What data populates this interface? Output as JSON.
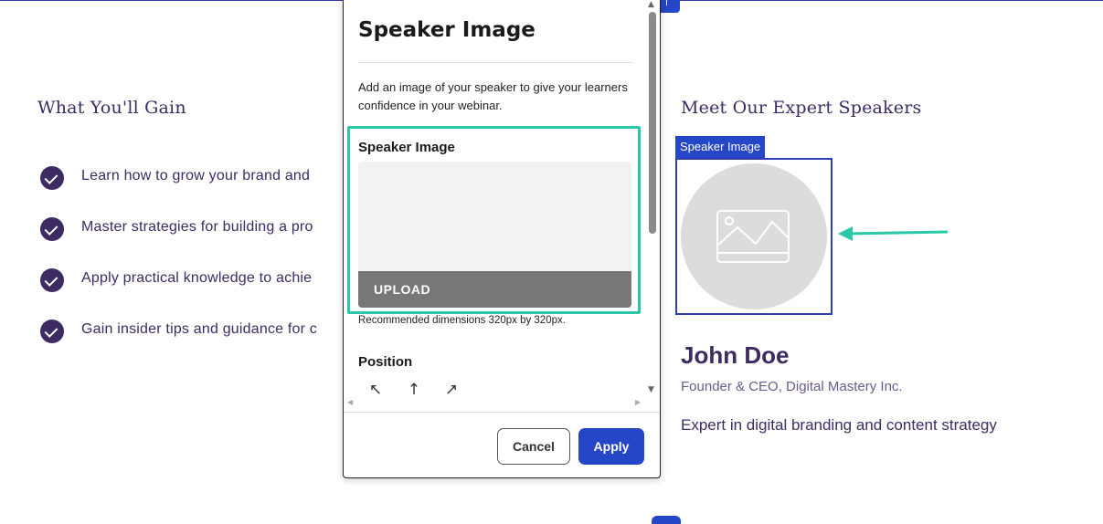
{
  "page": {
    "gain_section": {
      "title": "What You'll Gain",
      "items": [
        "Learn how to grow your brand and",
        "Master strategies for building a pro",
        "Apply practical knowledge to achie",
        "Gain insider tips and guidance for c"
      ]
    },
    "speakers_section": {
      "title": "Meet Our Expert Speakers",
      "image_tag": "Speaker Image",
      "speaker": {
        "name": "John Doe",
        "role": "Founder & CEO, Digital Mastery Inc.",
        "bio": "Expert in digital branding and content strategy"
      }
    }
  },
  "modal": {
    "title": "Speaker Image",
    "description": "Add an image of your speaker to give your learners confidence in your webinar.",
    "field_label": "Speaker Image",
    "upload_label": "UPLOAD",
    "hint": "Recommended dimensions 320px by 320px.",
    "position_label": "Position",
    "position_icons": [
      "↖",
      "↑",
      "↗"
    ],
    "cancel_label": "Cancel",
    "apply_label": "Apply"
  },
  "colors": {
    "brand_purple": "#3d2b63",
    "accent_blue": "#2446c7",
    "highlight_teal": "#2ac8a6"
  }
}
